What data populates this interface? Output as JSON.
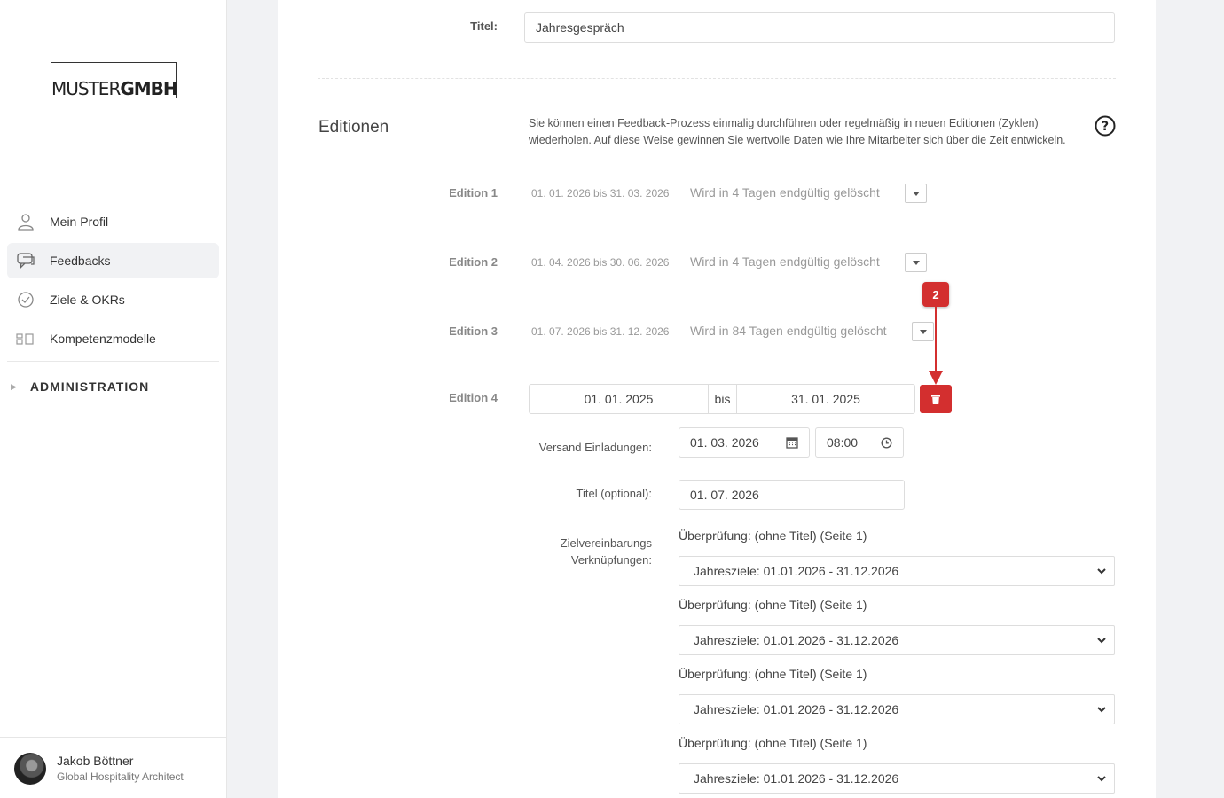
{
  "sidebar": {
    "logo": {
      "part1": "MUSTER",
      "part2": "GMBH"
    },
    "nav": [
      {
        "label": "Mein Profil",
        "icon": "user-icon",
        "active": false
      },
      {
        "label": "Feedbacks",
        "icon": "chat-icon",
        "active": true
      },
      {
        "label": "Ziele & OKRs",
        "icon": "check-circle-icon",
        "active": false
      },
      {
        "label": "Kompetenzmodelle",
        "icon": "blocks-icon",
        "active": false
      }
    ],
    "admin_label": "ADMINISTRATION",
    "user": {
      "name": "Jakob Böttner",
      "role": "Global Hospitality Architect"
    }
  },
  "form": {
    "title_label": "Titel:",
    "title_value": "Jahresgespräch",
    "editions_heading": "Editionen",
    "editions_description": "Sie können einen Feedback-Prozess einmalig durchführen oder regelmäßig in neuen Editionen (Zyklen) wiederholen. Auf diese Weise gewinnen Sie wertvolle Daten wie Ihre Mitarbeiter sich über die Zeit entwickeln.",
    "editions": [
      {
        "label": "Edition 1",
        "dates": "01. 01. 2026 bis 31. 03. 2026",
        "status": "Wird in 4 Tagen endgültig gelöscht"
      },
      {
        "label": "Edition 2",
        "dates": "01. 04. 2026 bis 30. 06. 2026",
        "status": "Wird in 4 Tagen endgültig gelöscht"
      },
      {
        "label": "Edition 3",
        "dates": "01. 07. 2026 bis 31. 12. 2026",
        "status": "Wird in 84 Tagen endgültig gelöscht"
      }
    ],
    "edition4": {
      "label": "Edition 4",
      "start": "01. 01. 2025",
      "bis": "bis",
      "end": "31. 01. 2025",
      "versand_label": "Versand Einladungen:",
      "versand_date": "01. 03. 2026",
      "versand_time": "08:00",
      "titel_optional_label": "Titel (optional):",
      "titel_optional_value": "01. 07. 2026",
      "ziel_label_1": "Zielvereinbarungs",
      "ziel_label_2": "Verknüpfungen:",
      "links": [
        {
          "heading": "Überprüfung: (ohne Titel) (Seite 1)",
          "selected": "Jahresziele: 01.01.2026 - 31.12.2026"
        },
        {
          "heading": "Überprüfung: (ohne Titel) (Seite 1)",
          "selected": "Jahresziele: 01.01.2026 - 31.12.2026"
        },
        {
          "heading": "Überprüfung: (ohne Titel) (Seite 1)",
          "selected": "Jahresziele: 01.01.2026 - 31.12.2026"
        },
        {
          "heading": "Überprüfung: (ohne Titel) (Seite 1)",
          "selected": "Jahresziele: 01.01.2026 - 31.12.2026"
        }
      ]
    }
  },
  "annotation": {
    "badge": "2",
    "color": "#d32f2f"
  }
}
